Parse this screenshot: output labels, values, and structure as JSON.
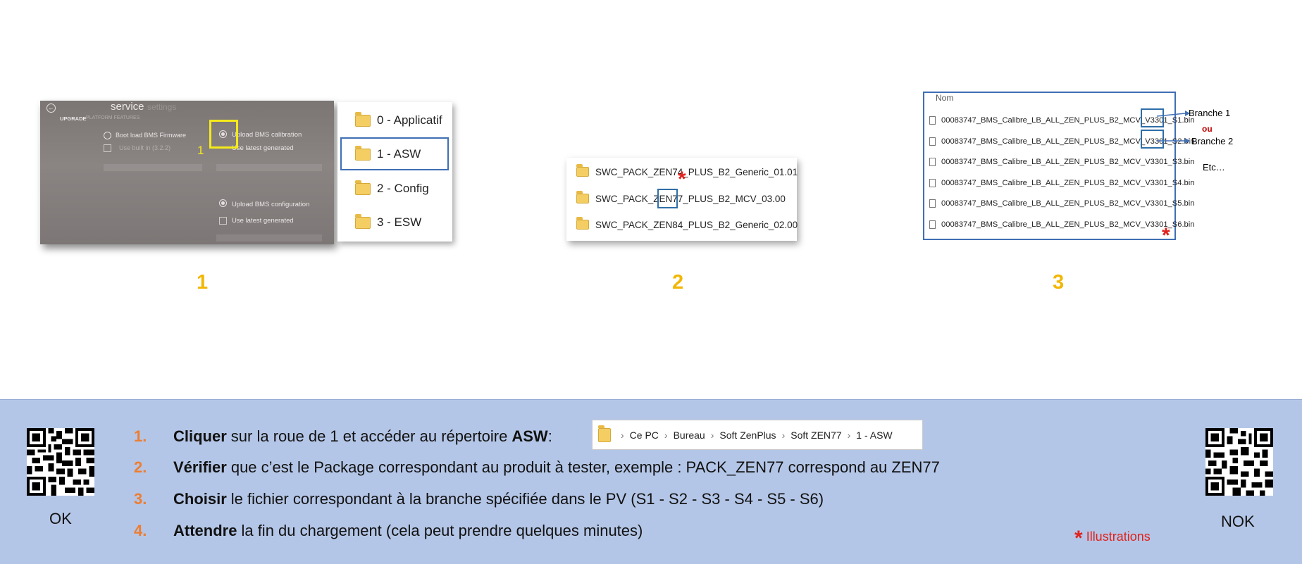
{
  "panel1": {
    "service_screen": {
      "title": "service",
      "title_suffix": "settings",
      "tab_upgrade": "UPGRADE",
      "tab_platform": "PLATFORM FEATURES",
      "boot_load": "Boot load BMS Firmware",
      "use_built_in": "Use built in (3.2.2)",
      "upload_calibration": "Upload BMS calibration",
      "use_latest_1": "Use latest generated",
      "upload_configuration": "Upload BMS configuration",
      "use_latest_2": "Use latest generated",
      "marker": "1"
    },
    "folders": [
      "0 - Applicatif",
      "1 - ASW",
      "2 - Config",
      "3 - ESW"
    ],
    "number": "1"
  },
  "panel2": {
    "packages": [
      "SWC_PACK_ZEN74_PLUS_B2_Generic_01.01",
      "SWC_PACK_ZEN77_PLUS_B2_MCV_03.00",
      "SWC_PACK_ZEN84_PLUS_B2_Generic_02.00"
    ],
    "star": "*",
    "number": "2"
  },
  "panel3": {
    "header": "Nom",
    "files": [
      "00083747_BMS_Calibre_LB_ALL_ZEN_PLUS_B2_MCV_V3301_S1.bin",
      "00083747_BMS_Calibre_LB_ALL_ZEN_PLUS_B2_MCV_V3301_S2.bin",
      "00083747_BMS_Calibre_LB_ALL_ZEN_PLUS_B2_MCV_V3301_S3.bin",
      "00083747_BMS_Calibre_LB_ALL_ZEN_PLUS_B2_MCV_V3301_S4.bin",
      "00083747_BMS_Calibre_LB_ALL_ZEN_PLUS_B2_MCV_V3301_S5.bin",
      "00083747_BMS_Calibre_LB_ALL_ZEN_PLUS_B2_MCV_V3301_S6.bin"
    ],
    "branch1": "Branche 1",
    "ou": "ou",
    "branch2": "Branche 2",
    "etc": "Etc…",
    "star": "*",
    "number": "3"
  },
  "instructions": {
    "steps": [
      {
        "num": "1.",
        "bold": "Cliquer",
        "text": "sur la roue de 1 et accéder au répertoire",
        "bold_end": "ASW",
        "suffix": ":"
      },
      {
        "num": "2.",
        "bold": "Vérifier",
        "text": "que c’est le Package correspondant au produit à tester, exemple : PACK_ZEN77 correspond au ZEN77"
      },
      {
        "num": "3.",
        "bold": "Choisir",
        "text": "le fichier correspondant à la branche spécifiée dans le PV (S1 - S2 - S3 - S4 - S5 - S6)"
      },
      {
        "num": "4.",
        "bold": "Attendre",
        "text": "la fin du chargement (cela peut prendre quelques minutes)"
      }
    ],
    "breadcrumb": [
      "Ce PC",
      "Bureau",
      "Soft ZenPlus",
      "Soft ZEN77",
      "1 - ASW"
    ],
    "qr_ok_label": "OK",
    "qr_nok_label": "NOK",
    "illustrations_star": "*",
    "illustrations_label": "Illustrations"
  },
  "colors": {
    "banner_bg": "#b4c6e7",
    "step_number": "#ed7d31",
    "panel_number": "#f2b705",
    "highlight_blue": "#2f6ea8",
    "star_red": "#e0221c",
    "highlight_yellow": "#f5ea1a"
  }
}
